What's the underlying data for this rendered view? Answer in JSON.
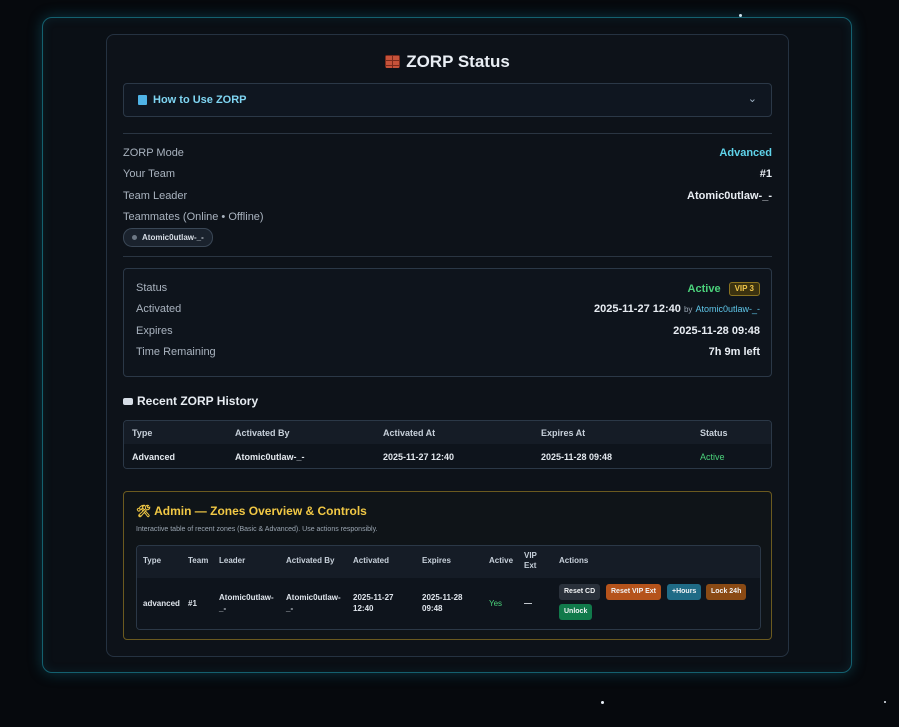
{
  "page": {
    "title": "ZORP Status"
  },
  "howto": {
    "label": "How to Use ZORP",
    "chevron": "⌄"
  },
  "info": [
    {
      "key": "ZORP Mode",
      "value": "Advanced"
    },
    {
      "key": "Your Team",
      "value": "#1"
    },
    {
      "key": "Team Leader",
      "value": "Atomic0utlaw-_-"
    },
    {
      "key": "Teammates (Online • Offline)",
      "value": ""
    }
  ],
  "teammates": [
    "Atomic0utlaw-_-"
  ],
  "status": {
    "status_label": "Status",
    "status_value": "Active",
    "vip_badge": "VIP 3",
    "activated_label": "Activated",
    "activated_value": "2025-11-27 12:40",
    "by_text": "by",
    "activated_by": "Atomic0utlaw-_-",
    "expires_label": "Expires",
    "expires_value": "2025-11-28 09:48",
    "remaining_label": "Time Remaining",
    "remaining_value": "7h 9m left"
  },
  "history": {
    "title": "Recent ZORP History",
    "columns": [
      "Type",
      "Activated By",
      "Activated At",
      "Expires At",
      "Status"
    ],
    "rows": [
      [
        "Advanced",
        "Atomic0utlaw-_-",
        "2025-11-27 12:40",
        "2025-11-28 09:48",
        "Active"
      ]
    ]
  },
  "admin": {
    "title": "🛠 Admin — Zones Overview & Controls",
    "subtitle": "Interactive table of recent zones (Basic & Advanced). Use actions responsibly.",
    "columns": [
      "Type",
      "Team",
      "Leader",
      "Activated By",
      "Activated",
      "Expires",
      "Active",
      "VIP Ext",
      "Actions"
    ],
    "row": {
      "type": "advanced",
      "team": "#1",
      "leader": "Atomic0utlaw-_-",
      "activated_by": "Atomic0utlaw-_-",
      "activated": "2025-11-27 12:40",
      "expires": "2025-11-28 09:48",
      "active": "Yes",
      "vip_ext": "—"
    },
    "actions": [
      "Reset CD",
      "Reset VIP Ext",
      "+Hours",
      "Lock 24h",
      "Unlock"
    ]
  },
  "colors": {
    "accent": "#5fd3ea",
    "active": "#4bd27b",
    "admin": "#f1c845",
    "frame": "#14606f"
  }
}
